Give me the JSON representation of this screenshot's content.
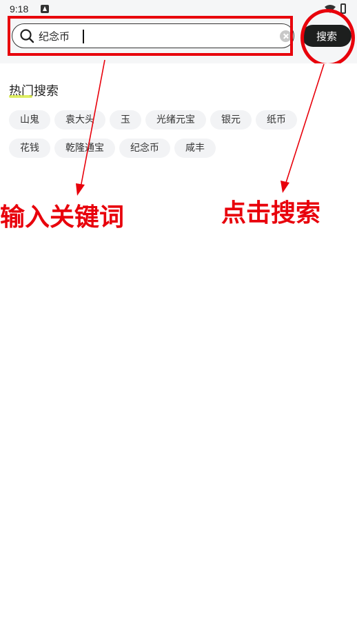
{
  "status_bar": {
    "time": "9:18"
  },
  "search": {
    "value": "纪念币",
    "button_label": "搜索"
  },
  "hot_search": {
    "title": "热门搜索",
    "tags": [
      "山鬼",
      "袁大头",
      "玉",
      "光绪元宝",
      "银元",
      "纸币",
      "花钱",
      "乾隆通宝",
      "纪念币",
      "咸丰"
    ]
  },
  "annotations": {
    "left_label": "输入关键词",
    "right_label": "点击搜索",
    "color": "#e8000b"
  },
  "colors": {
    "button_bg": "#1d1f1e",
    "tag_bg": "#f2f3f5",
    "header_bg": "#f5f6f7",
    "accent_underline": "#d6ea3d"
  }
}
